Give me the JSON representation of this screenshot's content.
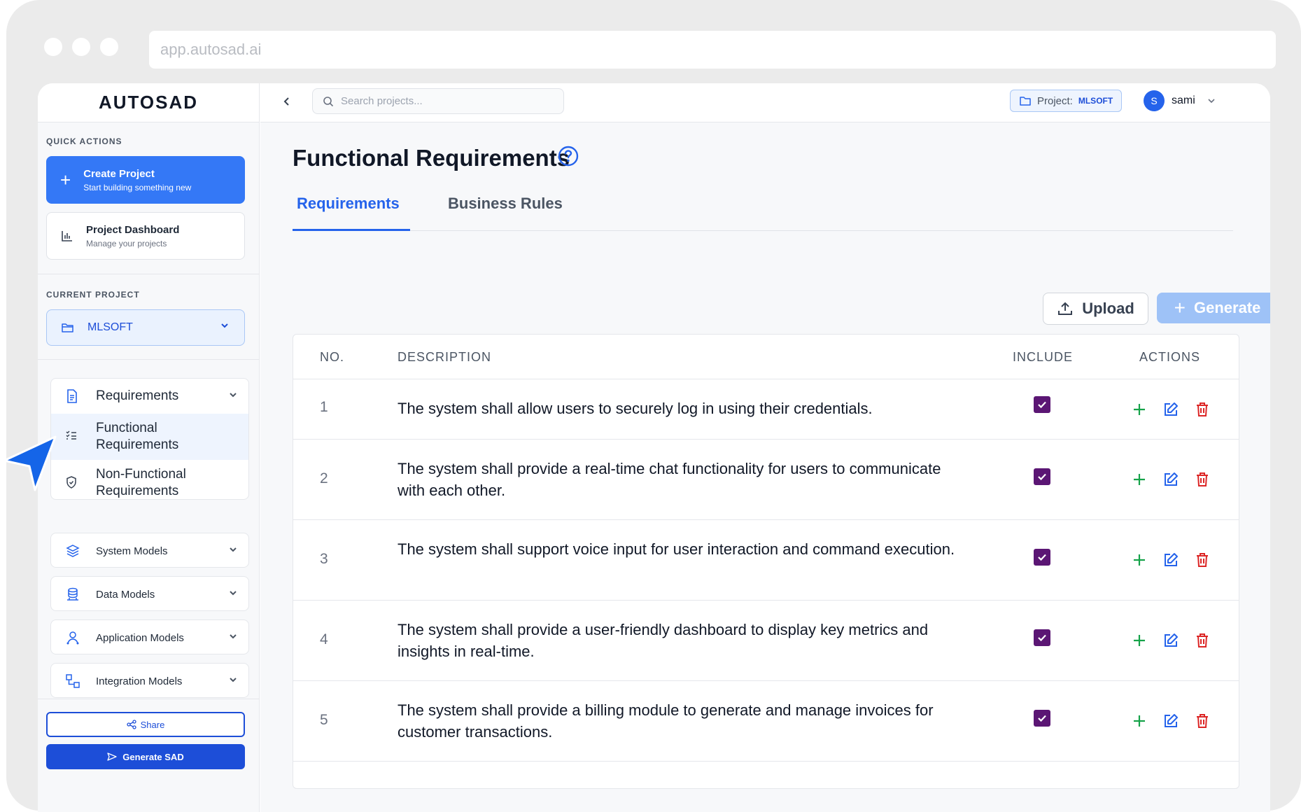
{
  "browser": {
    "url": "app.autosad.ai"
  },
  "sidebar": {
    "logo": "AUTOSAD",
    "quick_actions_label": "QUICK ACTIONS",
    "create_project": {
      "title": "Create Project",
      "subtitle": "Start building something new"
    },
    "project_dashboard": {
      "title": "Project Dashboard",
      "subtitle": "Manage your projects"
    },
    "current_project_label": "CURRENT PROJECT",
    "current_project": "MLSOFT",
    "requirements_group": {
      "label": "Requirements",
      "items": [
        {
          "label": "Functional Requirements",
          "active": true
        },
        {
          "label": "Non-Functional Requirements",
          "active": false
        }
      ]
    },
    "groups": [
      {
        "label": "System Models"
      },
      {
        "label": "Data Models"
      },
      {
        "label": "Application Models"
      },
      {
        "label": "Integration Models"
      }
    ],
    "share_label": "Share",
    "generate_sad_label": "Generate SAD"
  },
  "topbar": {
    "search_placeholder": "Search projects...",
    "project_label": "Project:",
    "project_value": "MLSOFT",
    "user_initial": "S",
    "user_name": "sami"
  },
  "main": {
    "title": "Functional Requirements",
    "tabs": [
      {
        "label": "Requirements",
        "active": true
      },
      {
        "label": "Business Rules",
        "active": false
      }
    ],
    "upload_label": "Upload",
    "generate_label": "Generate",
    "table": {
      "headers": {
        "no": "NO.",
        "description": "DESCRIPTION",
        "include": "INCLUDE",
        "actions": "ACTIONS"
      },
      "rows": [
        {
          "no": "1",
          "description": "The system shall allow users to securely log in using their credentials.",
          "include": true
        },
        {
          "no": "2",
          "description": "The system shall provide a real-time chat functionality for users to communicate with each other.",
          "include": true
        },
        {
          "no": "3",
          "description": "The system shall support voice input for user interaction and command execution.",
          "include": true
        },
        {
          "no": "4",
          "description": "The system shall provide a user-friendly dashboard to display key metrics and insights in real-time.",
          "include": true
        },
        {
          "no": "5",
          "description": "The system shall provide a billing module to generate and manage invoices for customer transactions.",
          "include": true
        }
      ]
    }
  },
  "colors": {
    "primary": "#3478f6",
    "primary_dark": "#1d4ed8",
    "checkbox": "#5b1674",
    "add": "#16a34a",
    "edit": "#2563eb",
    "delete": "#dc2626",
    "cursor": "#1565e8"
  }
}
